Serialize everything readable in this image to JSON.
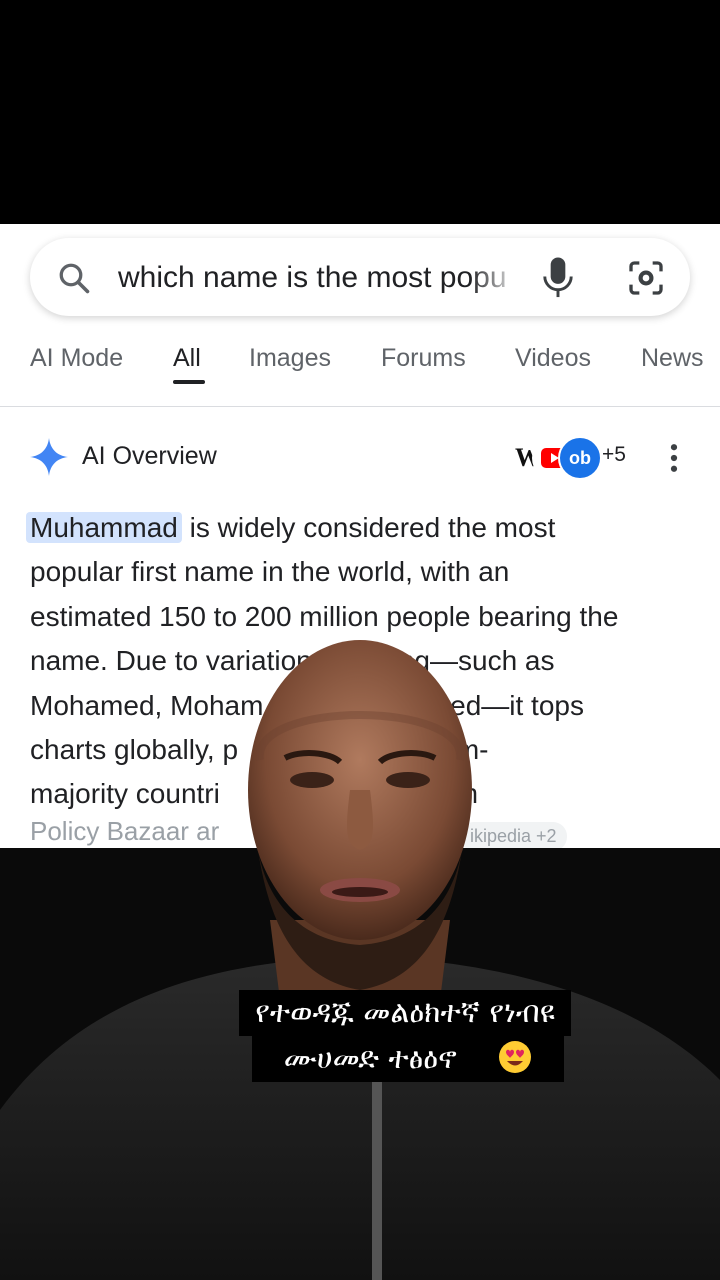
{
  "search": {
    "query": "which name is the most popu"
  },
  "tabs": [
    {
      "label": "AI Mode"
    },
    {
      "label": "All"
    },
    {
      "label": "Images"
    },
    {
      "label": "Forums"
    },
    {
      "label": "Videos"
    },
    {
      "label": "News"
    }
  ],
  "ai_overview": {
    "title": "AI Overview",
    "sources_count": "+5",
    "highlight_term": "Muhammad",
    "body_lines": [
      " is widely considered the most",
      "popular first name in the world, with an",
      "estimated 150 to 200 million people bearing the",
      "name. Due to variation   spelling—such as",
      "Mohamed, Moham              hammed—it tops",
      "charts globally, p               ss Muslim-",
      "majority countri                 ports from"
    ],
    "citation_line": "Policy Bazaar ar",
    "citation_chip": "ikipedia +2"
  },
  "caption": {
    "line1": "የተወዳጁ መልዕክተኛ የነብዩ",
    "line2": "ሙሀመድ ተፅዕኖ"
  },
  "colors": {
    "accent_blue": "#1a73e8",
    "highlight": "#d3e3fd",
    "text": "#202124",
    "muted": "#5f6368"
  }
}
